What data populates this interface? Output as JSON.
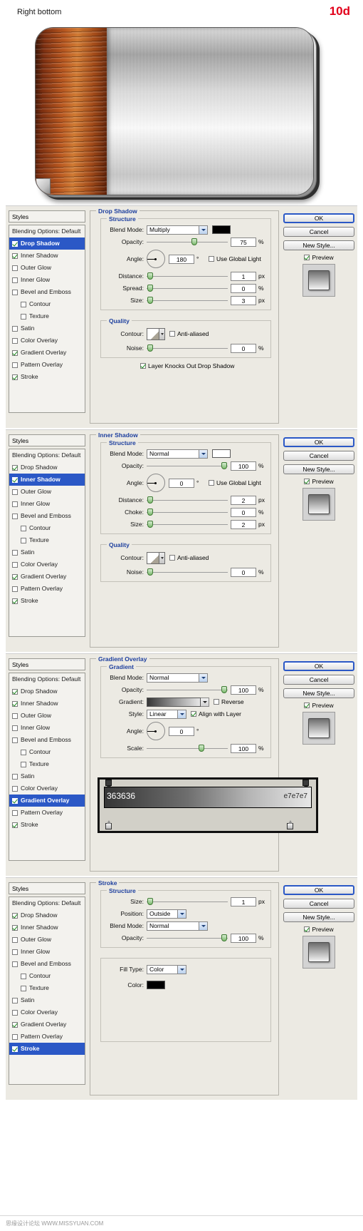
{
  "header": {
    "title": "Right bottom",
    "step": "10d"
  },
  "hero": {
    "name": "metal-wood-plate-preview"
  },
  "styles_panel": {
    "header": "Styles",
    "blending_options": "Blending Options: Default",
    "items": [
      {
        "label": "Drop Shadow",
        "checked": true,
        "indent": false
      },
      {
        "label": "Inner Shadow",
        "checked": true,
        "indent": false
      },
      {
        "label": "Outer Glow",
        "checked": false,
        "indent": false
      },
      {
        "label": "Inner Glow",
        "checked": false,
        "indent": false
      },
      {
        "label": "Bevel and Emboss",
        "checked": false,
        "indent": false
      },
      {
        "label": "Contour",
        "checked": false,
        "indent": true
      },
      {
        "label": "Texture",
        "checked": false,
        "indent": true
      },
      {
        "label": "Satin",
        "checked": false,
        "indent": false
      },
      {
        "label": "Color Overlay",
        "checked": false,
        "indent": false
      },
      {
        "label": "Gradient Overlay",
        "checked": true,
        "indent": false
      },
      {
        "label": "Pattern Overlay",
        "checked": false,
        "indent": false
      },
      {
        "label": "Stroke",
        "checked": true,
        "indent": false
      }
    ],
    "selected": [
      "Drop Shadow",
      "Inner Shadow",
      "Gradient Overlay",
      "Stroke"
    ]
  },
  "buttons": {
    "ok": "OK",
    "cancel": "Cancel",
    "new_style": "New Style...",
    "preview": "Preview",
    "preview_checked": true
  },
  "labels": {
    "structure": "Structure",
    "quality": "Quality",
    "gradient": "Gradient",
    "blend_mode": "Blend Mode:",
    "opacity": "Opacity:",
    "angle": "Angle:",
    "distance": "Distance:",
    "spread": "Spread:",
    "choke": "Choke:",
    "size": "Size:",
    "contour": "Contour:",
    "noise": "Noise:",
    "use_global_light": "Use Global Light",
    "anti_aliased": "Anti-aliased",
    "layer_knocks_out": "Layer Knocks Out Drop Shadow",
    "gradient_label": "Gradient:",
    "reverse": "Reverse",
    "style": "Style:",
    "align_with_layer": "Align with Layer",
    "scale": "Scale:",
    "position": "Position:",
    "fill_type": "Fill Type:",
    "color": "Color:",
    "unit_px": "px",
    "unit_pct": "%",
    "unit_deg": "°"
  },
  "panels": [
    {
      "name": "drop-shadow",
      "title": "Drop Shadow",
      "blend_mode": "Multiply",
      "color": "#000000",
      "opacity": "75",
      "angle": "180",
      "use_global_light": false,
      "distance": "1",
      "spread": "0",
      "size": "3",
      "anti_aliased": false,
      "noise": "0",
      "layer_knocks_out": true
    },
    {
      "name": "inner-shadow",
      "title": "Inner Shadow",
      "blend_mode": "Normal",
      "color": "#ffffff",
      "opacity": "100",
      "angle": "0",
      "use_global_light": false,
      "distance": "2",
      "choke": "0",
      "size": "2",
      "anti_aliased": false,
      "noise": "0"
    },
    {
      "name": "gradient-overlay",
      "title": "Gradient Overlay",
      "blend_mode": "Normal",
      "opacity": "100",
      "reverse": false,
      "style": "Linear",
      "align_with_layer": true,
      "angle": "0",
      "scale": "100",
      "gradient_from": "#363636",
      "gradient_to": "#e7e7e7"
    },
    {
      "name": "stroke",
      "title": "Stroke",
      "size": "1",
      "position": "Outside",
      "blend_mode": "Normal",
      "opacity": "100",
      "fill_type": "Color",
      "color": "#000000"
    }
  ],
  "gradient_editor": {
    "from_hex": "363636",
    "to_hex": "e7e7e7"
  },
  "footer": {
    "watermark": "思缘设计论坛  WWW.MISSYUAN.COM"
  }
}
